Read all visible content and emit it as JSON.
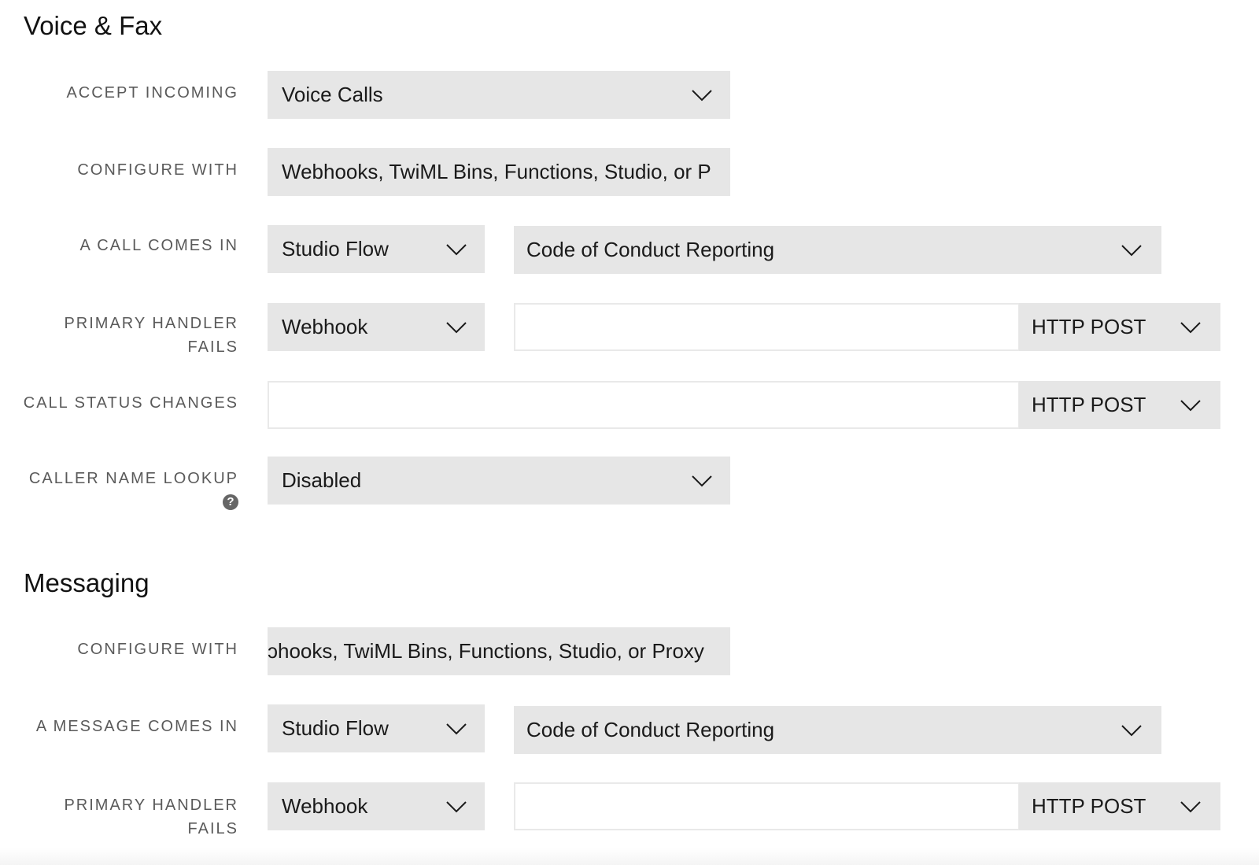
{
  "voice_fax": {
    "title": "Voice & Fax",
    "accept_incoming": {
      "label": "ACCEPT INCOMING",
      "value": "Voice Calls"
    },
    "configure_with": {
      "label": "CONFIGURE WITH",
      "value": "Webhooks, TwiML Bins, Functions, Studio, or P"
    },
    "call_comes_in": {
      "label": "A CALL COMES IN",
      "type": "Studio Flow",
      "target": "Code of Conduct Reporting"
    },
    "primary_handler_fails": {
      "label_line1": "PRIMARY HANDLER",
      "label_line2": "FAILS",
      "type": "Webhook",
      "url": "",
      "method": "HTTP POST"
    },
    "call_status_changes": {
      "label": "CALL STATUS CHANGES",
      "url": "",
      "method": "HTTP POST"
    },
    "caller_name_lookup": {
      "label": "CALLER NAME LOOKUP",
      "help_icon": "?",
      "value": "Disabled"
    }
  },
  "messaging": {
    "title": "Messaging",
    "configure_with": {
      "label": "CONFIGURE WITH",
      "value": "ɔhooks, TwiML Bins, Functions, Studio, or Proxy"
    },
    "message_comes_in": {
      "label": "A MESSAGE COMES IN",
      "type": "Studio Flow",
      "target": "Code of Conduct Reporting"
    },
    "primary_handler_fails": {
      "label_line1": "PRIMARY HANDLER",
      "label_line2": "FAILS",
      "type": "Webhook",
      "url": "",
      "method": "HTTP POST"
    }
  }
}
